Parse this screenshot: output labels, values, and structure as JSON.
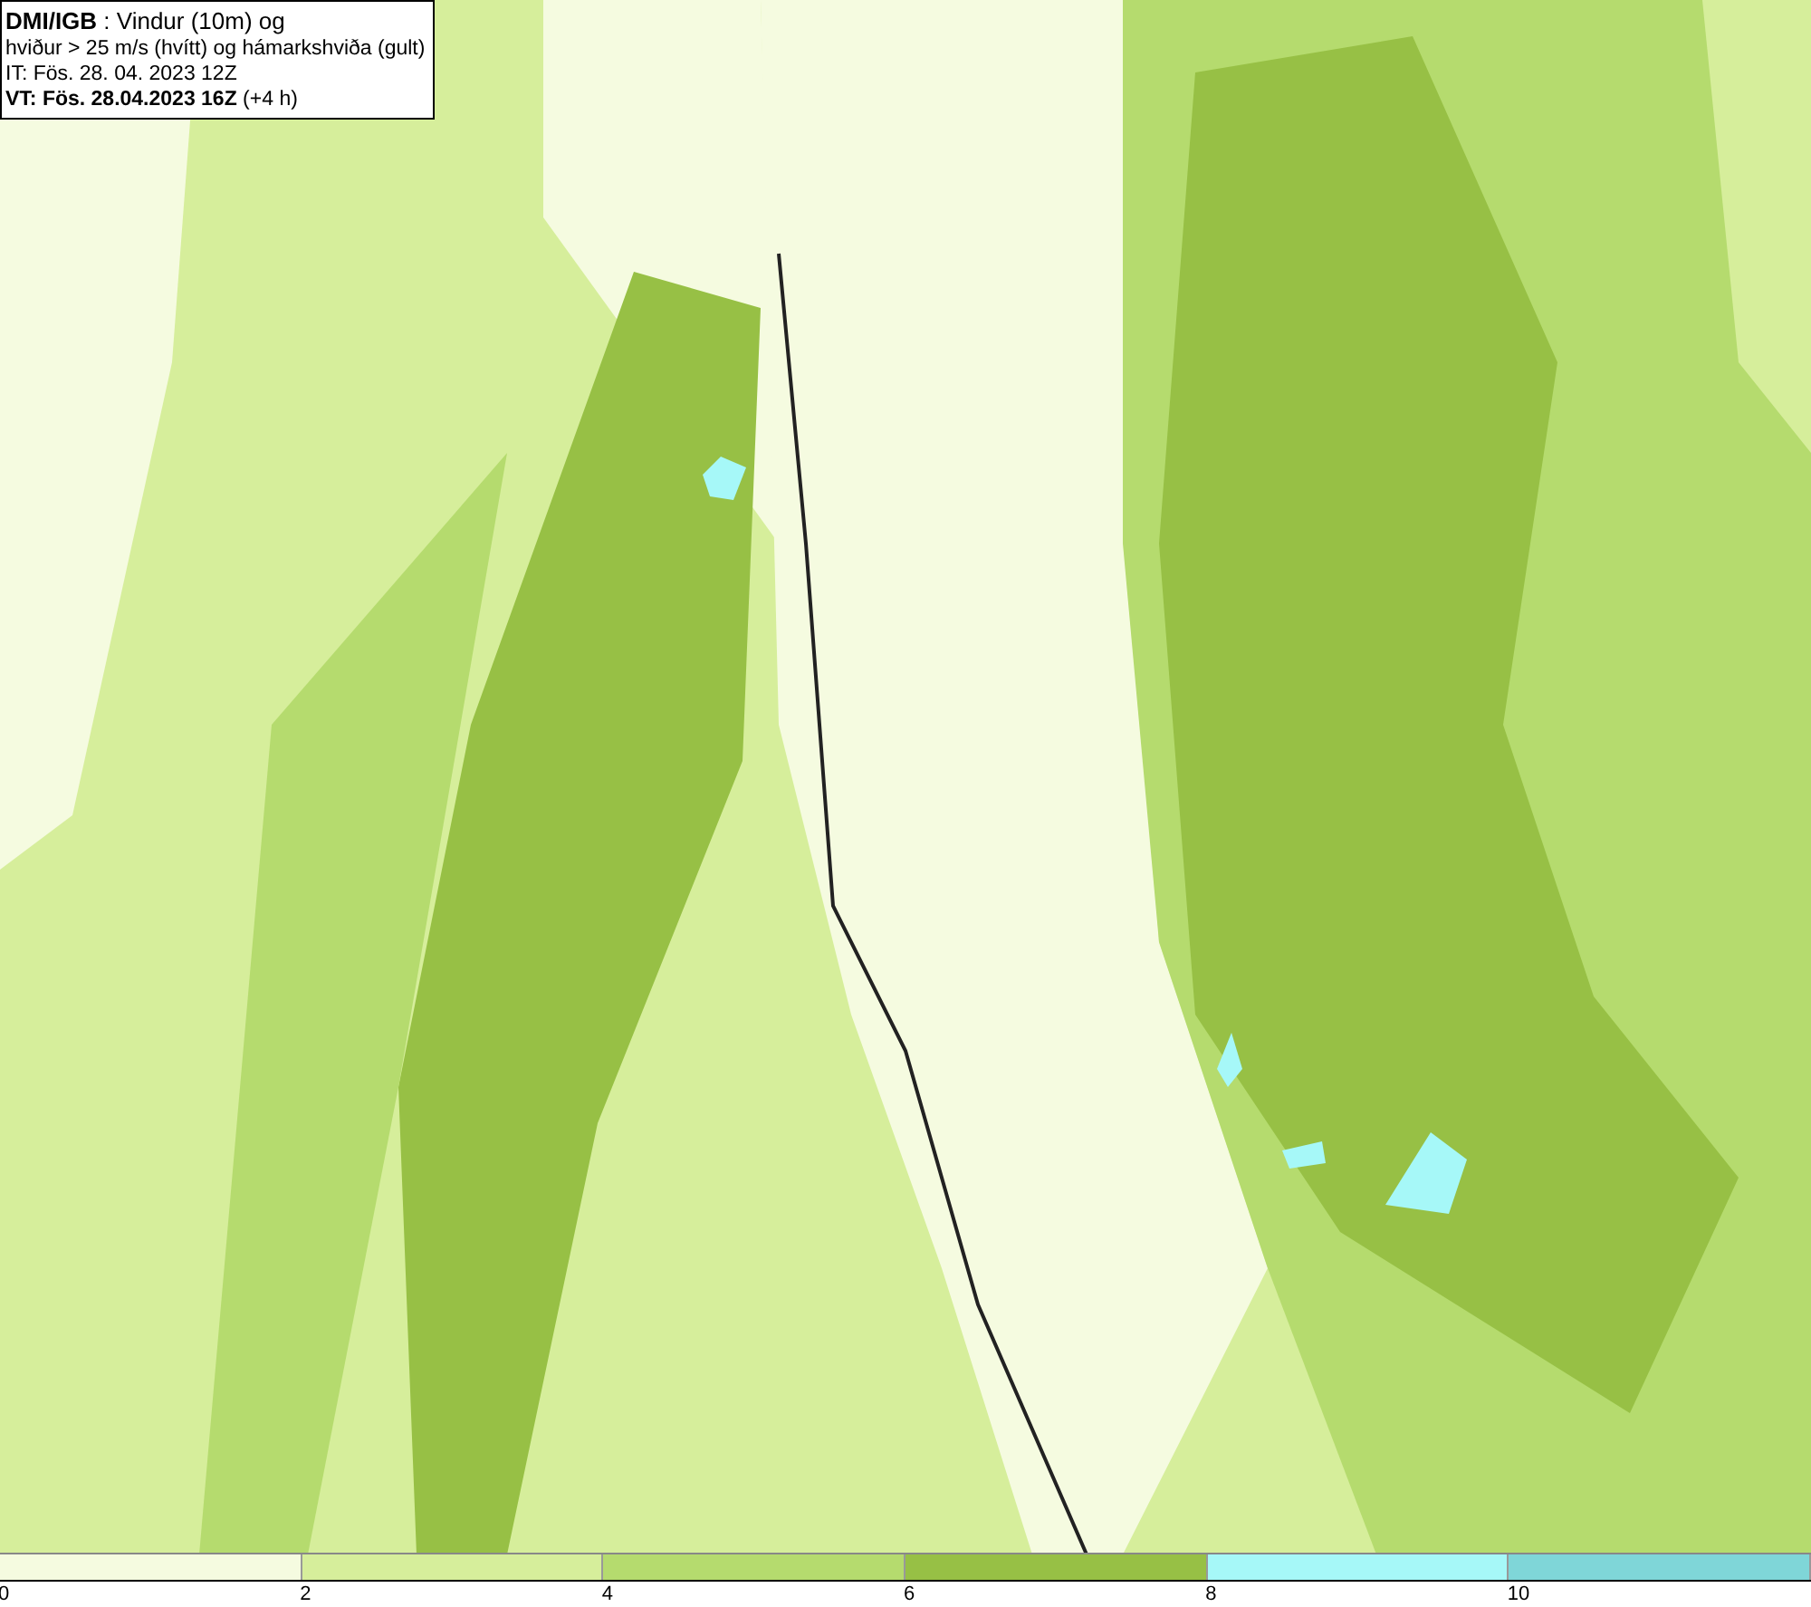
{
  "header": {
    "lines": [
      "**DMI/IGB** : Vindur (10m) og",
      "hviður > 25 m/s (hvítt) og hámarkshviða (gult)",
      "IT: Fös. 28. 04. 2023 12Z",
      "**VT: Fös. 28.04.2023 16Z** (+4 h)"
    ]
  },
  "colorbar": [
    {
      "label": "0",
      "color": "#f5fbe0"
    },
    {
      "label": "2",
      "color": "#d6ee9b"
    },
    {
      "label": "4",
      "color": "#b5db6e"
    },
    {
      "label": "6",
      "color": "#97c045"
    },
    {
      "label": "8",
      "color": "#a6f8f8"
    },
    {
      "label": "10",
      "color": "#7fd6d8"
    }
  ]
}
